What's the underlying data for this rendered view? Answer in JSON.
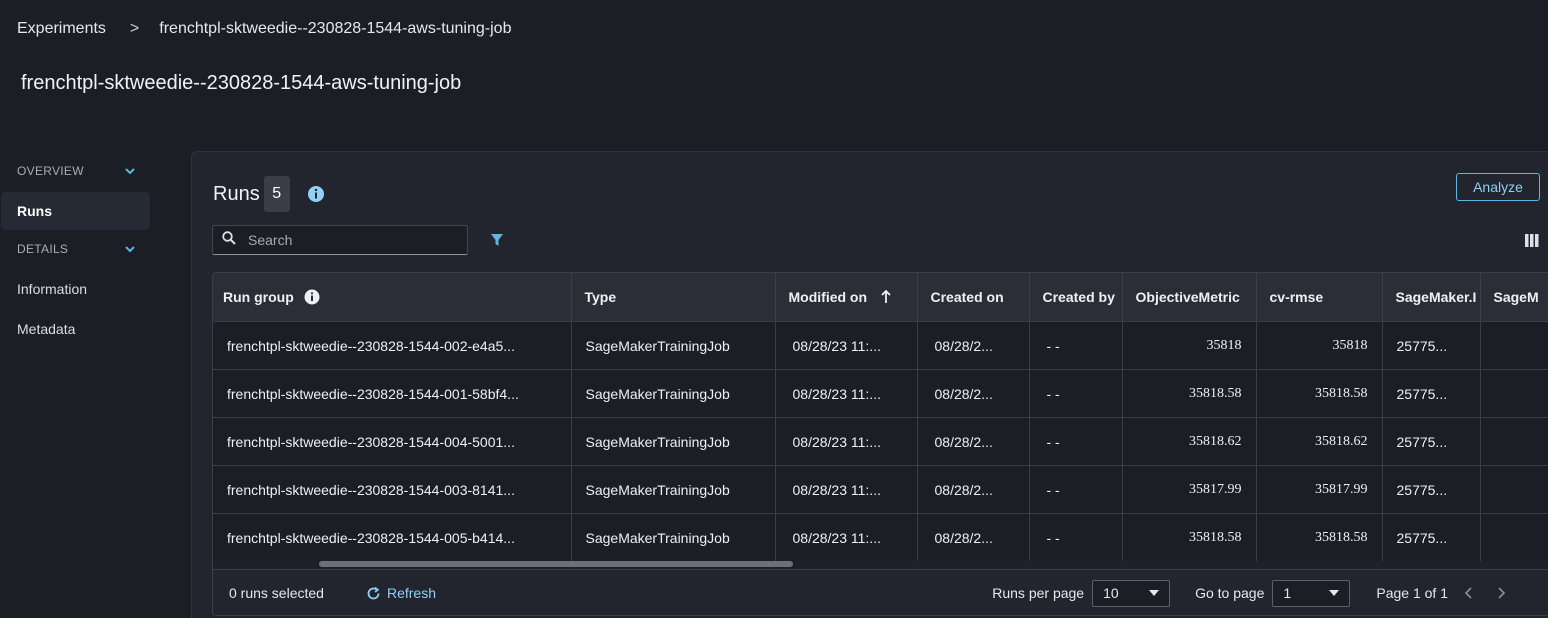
{
  "breadcrumb": {
    "root": "Experiments",
    "separator": ">",
    "current": "frenchtpl-sktweedie--230828-1544-aws-tuning-job"
  },
  "page_title": "frenchtpl-sktweedie--230828-1544-aws-tuning-job",
  "sidebar": {
    "overview": "OVERVIEW",
    "runs": "Runs",
    "details": "DETAILS",
    "information": "Information",
    "metadata": "Metadata"
  },
  "runs": {
    "title": "Runs",
    "count": "5",
    "analyze_label": "Analyze",
    "search_placeholder": "Search"
  },
  "table": {
    "headers": [
      "Run group",
      "Type",
      "Modified on",
      "Created on",
      "Created by",
      "ObjectiveMetric",
      "cv-rmse",
      "SageMaker.I",
      "SageM"
    ],
    "rows": [
      [
        "frenchtpl-sktweedie--230828-1544-002-e4a5...",
        "SageMakerTrainingJob",
        "08/28/23 11:...",
        "08/28/2...",
        "- -",
        "35818",
        "35818",
        "25775...",
        ""
      ],
      [
        "frenchtpl-sktweedie--230828-1544-001-58bf4...",
        "SageMakerTrainingJob",
        "08/28/23 11:...",
        "08/28/2...",
        "- -",
        "35818.58",
        "35818.58",
        "25775...",
        ""
      ],
      [
        "frenchtpl-sktweedie--230828-1544-004-5001...",
        "SageMakerTrainingJob",
        "08/28/23 11:...",
        "08/28/2...",
        "- -",
        "35818.62",
        "35818.62",
        "25775...",
        ""
      ],
      [
        "frenchtpl-sktweedie--230828-1544-003-8141...",
        "SageMakerTrainingJob",
        "08/28/23 11:...",
        "08/28/2...",
        "- -",
        "35817.99",
        "35817.99",
        "25775...",
        ""
      ],
      [
        "frenchtpl-sktweedie--230828-1544-005-b414...",
        "SageMakerTrainingJob",
        "08/28/23 11:...",
        "08/28/2...",
        "- -",
        "35818.58",
        "35818.58",
        "25775...",
        ""
      ]
    ]
  },
  "footer": {
    "selected": "0 runs selected",
    "refresh": "Refresh",
    "runs_per_page_label": "Runs per page",
    "runs_per_page_value": "10",
    "go_to_page_label": "Go to page",
    "go_to_page_value": "1",
    "page_info": "Page 1 of 1"
  },
  "colors": {
    "accent": "#8fd0f5",
    "background": "#1c1e26",
    "panel": "#22252e"
  }
}
